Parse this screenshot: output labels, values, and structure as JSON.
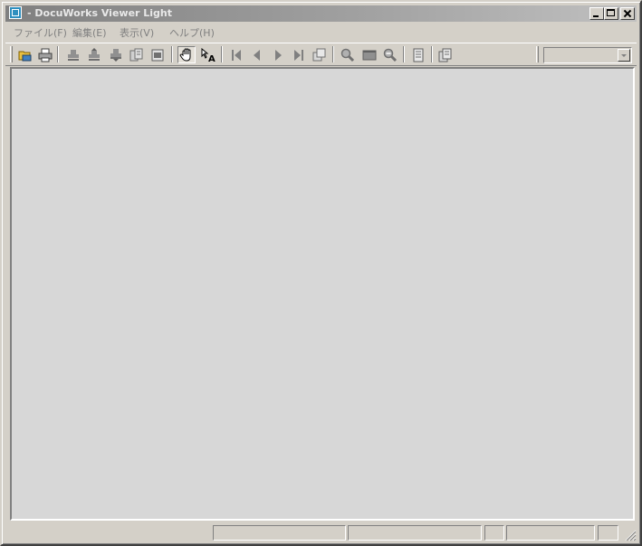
{
  "window": {
    "title": "- DocuWorks Viewer Light",
    "icon": "docuworks-app-icon"
  },
  "menu": {
    "items": [
      "ファイル(F)",
      "編集(E)",
      "表示(V)",
      "ヘルプ(H)"
    ]
  },
  "toolbar": {
    "tools": [
      {
        "name": "open-file-icon",
        "enabled": true
      },
      {
        "name": "print-icon",
        "enabled": true
      },
      {
        "name": "stamp-icon",
        "enabled": false
      },
      {
        "name": "stamp-up-icon",
        "enabled": false
      },
      {
        "name": "stamp-down-icon",
        "enabled": false
      },
      {
        "name": "copy-pages-icon",
        "enabled": false
      },
      {
        "name": "page-image-icon",
        "enabled": false
      },
      {
        "name": "hand-tool-icon",
        "enabled": true,
        "active": true
      },
      {
        "name": "text-select-icon",
        "enabled": true
      },
      {
        "name": "first-page-icon",
        "enabled": false
      },
      {
        "name": "previous-page-icon",
        "enabled": false
      },
      {
        "name": "next-page-icon",
        "enabled": false
      },
      {
        "name": "last-page-icon",
        "enabled": false
      },
      {
        "name": "go-to-page-icon",
        "enabled": false
      },
      {
        "name": "zoom-in-icon",
        "enabled": false
      },
      {
        "name": "fit-page-icon",
        "enabled": false
      },
      {
        "name": "zoom-out-icon",
        "enabled": false
      },
      {
        "name": "single-page-icon",
        "enabled": false
      },
      {
        "name": "multi-page-icon",
        "enabled": false
      }
    ],
    "zoom_combo_value": ""
  },
  "status": {
    "panels": [
      "",
      "",
      "",
      "",
      "",
      "",
      ""
    ]
  },
  "colors": {
    "face": "#d4d0c8",
    "client": "#d7d7d7",
    "title_gradient_start": "#808080",
    "title_gradient_end": "#c0c0c0",
    "disabled_text": "#808080",
    "desktop": "#3a6ea5"
  }
}
